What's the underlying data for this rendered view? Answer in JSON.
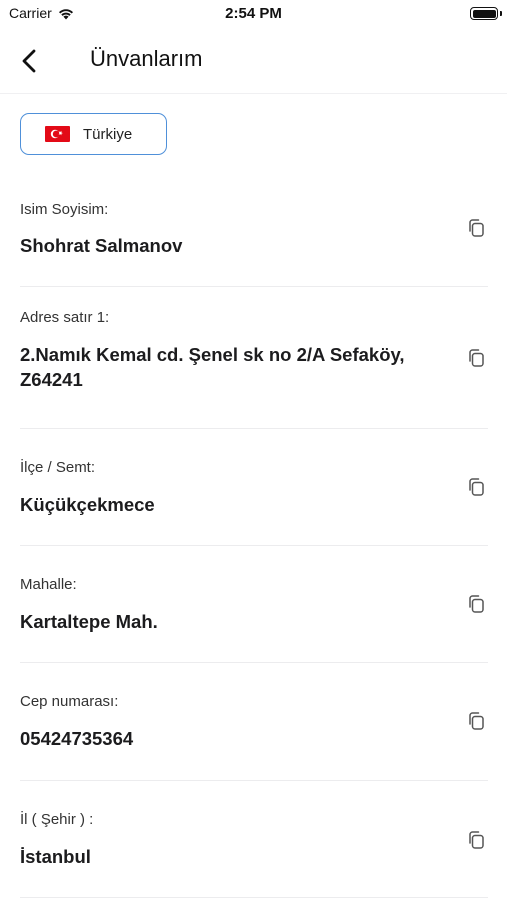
{
  "status_bar": {
    "carrier": "Carrier",
    "time": "2:54 PM",
    "icons": [
      "wifi-icon",
      "battery-icon"
    ]
  },
  "nav": {
    "title": "Ünvanlarım",
    "back_icon": "chevron-left-icon"
  },
  "country": {
    "label": "Türkiye",
    "flag_icon": "turkey-flag-icon",
    "accent": "#4f90d9"
  },
  "fields": [
    {
      "label": "Isim Soyisim:",
      "value": "Shohrat Salmanov"
    },
    {
      "label": "Adres satır 1:",
      "value": "2.Namık Kemal cd. Şenel sk no 2/A Sefaköy, Z64241"
    },
    {
      "label": "İlçe / Semt:",
      "value": "Küçükçekmece"
    },
    {
      "label": "Mahalle:",
      "value": "Kartaltepe Mah."
    },
    {
      "label": "Cep numarası:",
      "value": "05424735364"
    },
    {
      "label": "İl ( Şehir ) :",
      "value": "İstanbul"
    }
  ],
  "copy_icon": "copy-icon"
}
